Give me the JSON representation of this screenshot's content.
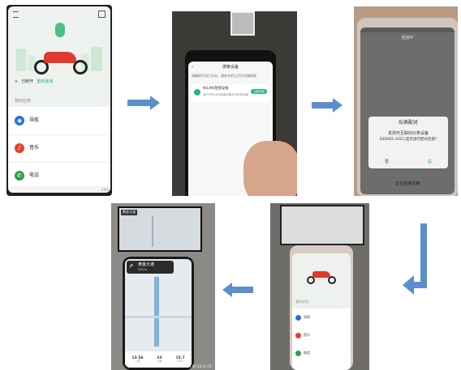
{
  "panel1": {
    "status_left": "已断开",
    "status_right": "重新连接",
    "section": "我的应用",
    "apps": [
      {
        "label": "导航",
        "color": "#2a6fd6"
      },
      {
        "label": "音乐",
        "color": "#e2432c"
      },
      {
        "label": "电话",
        "color": "#2f9e44"
      }
    ],
    "corner_code": "202"
  },
  "panel2": {
    "title": "搜索设备",
    "hint": "请确保手机已开启，请在车机上打开设备搜索",
    "device_name": "WLAN连接设备",
    "device_desc": "请打开WLAN连接设备并与车机连接",
    "connect_btn": "立即连接"
  },
  "panel3": {
    "title": "连接中",
    "dialog_title": "仪表配对",
    "dialog_msg1": "发现可互联的仪表设备",
    "dialog_msg2": "SSD001-2021,是否进行配对连接?",
    "btn_no": "否",
    "btn_yes": "是",
    "bottom_text": "正在连接车辆"
  },
  "panel4": {
    "section": "我的应用",
    "apps": [
      "导航",
      "音乐",
      "电话"
    ]
  },
  "panel5": {
    "small_turn": "黄金大道",
    "turn_road": "黄金大道",
    "turn_dist": "300 m",
    "stats": [
      {
        "value": "13.56",
        "label": "公里"
      },
      {
        "value": "23",
        "label": "分钟"
      },
      {
        "value": "15.7",
        "label": "km/h"
      }
    ],
    "timestamp": "2023.06.14  15:31"
  },
  "colors": {
    "arrow": "#5b8fc9",
    "green": "#2bb673",
    "bike_red": "#e03a2f"
  }
}
